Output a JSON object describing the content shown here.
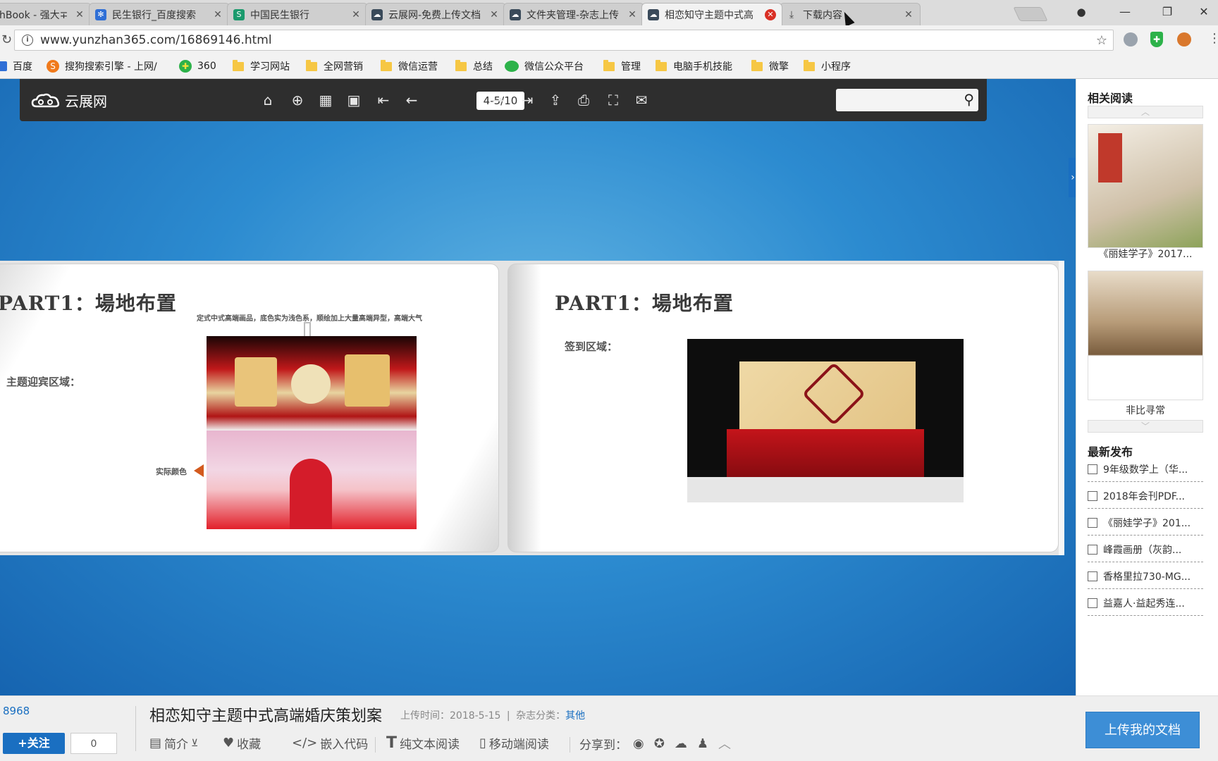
{
  "browser": {
    "tabs": [
      {
        "title": "hBook - 强大∓",
        "icon": "page-icon"
      },
      {
        "title": "民生银行_百度搜索",
        "icon": "baidu-paw-icon"
      },
      {
        "title": "中国民生银行",
        "icon": "minsheng-logo-icon"
      },
      {
        "title": "云展网-免费上传文档",
        "icon": "yunzhan-cloud-icon"
      },
      {
        "title": "文件夹管理-杂志上传",
        "icon": "yunzhan-cloud-icon"
      },
      {
        "title": "相恋知守主题中式高",
        "icon": "yunzhan-cloud-icon"
      },
      {
        "title": "下载内容",
        "icon": "download-icon"
      }
    ],
    "active_tab": 5,
    "url": "www.yunzhan365.com/16869146.html",
    "bookmarks": [
      "百度",
      "搜狗搜索引擎 - 上网/",
      "360",
      "学习网站",
      "全网营销",
      "微信运营",
      "总结",
      "微信公众平台",
      "管理",
      "电脑手机技能",
      "微擎",
      "小程序"
    ]
  },
  "viewer": {
    "logo": "云展网",
    "page_indicator": "4-5/10",
    "search_placeholder": ""
  },
  "book": {
    "left": {
      "title": "PART1：場地布置",
      "caption": "定式中式高端画品，底色实为浅色系，顺绘加上大量高端异型，高端大气",
      "area_label": "主题迎宾区域：",
      "color_note": "实际颜色"
    },
    "right": {
      "title": "PART1：場地布置",
      "area_label": "签到区域："
    }
  },
  "sidebar": {
    "related_heading": "相关阅读",
    "related": [
      {
        "caption": "《丽娃学子》2017..."
      },
      {
        "caption": "非比寻常"
      }
    ],
    "latest_heading": "最新发布",
    "latest": [
      "9年级数学上（华...",
      "2018年会刊PDF...",
      "《丽娃学子》201...",
      "峰霞画册（灰韵...",
      "香格里拉730-MG...",
      "益嘉人·益起秀连..."
    ]
  },
  "footer": {
    "views": "8968",
    "follow_label": "+关注",
    "follow_count": "0",
    "doc_title": "相恋知守主题中式高端婚庆策划案",
    "upload_time_label": "上传时间：2018-5-15",
    "category_label": "杂志分类：",
    "category_value": "其他",
    "actions": [
      "简介",
      "收藏",
      "嵌入代码",
      "纯文本阅读",
      "移动端阅读"
    ],
    "share_label": "分享到：",
    "upload_button": "上传我的文档"
  },
  "colors": {
    "accent": "#1a6fc1",
    "toolbar_bg": "#2e2e2e",
    "viewer_bg": "#2c8bd0"
  }
}
